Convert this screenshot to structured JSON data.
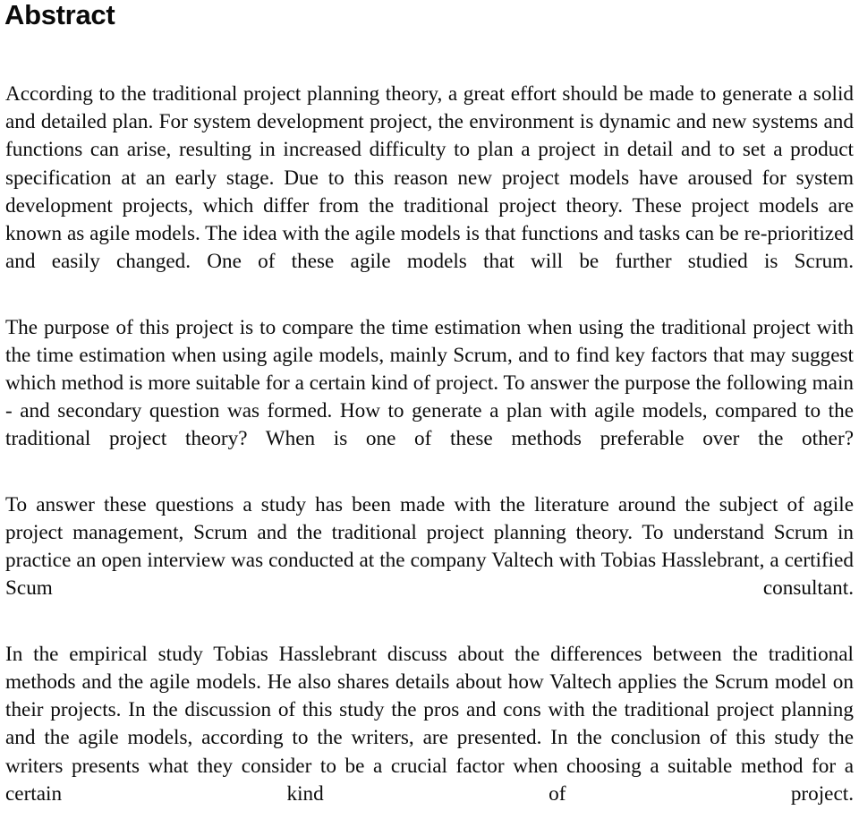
{
  "document": {
    "title": "Abstract",
    "paragraphs": [
      "According to the traditional project planning theory, a great effort should be made to generate a solid and detailed plan. For system development project, the environment is dynamic and new systems and functions can arise, resulting in increased difficulty to plan a project in detail and to set a product specification at an early stage. Due to this reason new project models have aroused for system development projects, which differ from the traditional project theory. These project models are known as agile models. The idea with the agile models is that functions and tasks can be re-prioritized and easily changed. One of these agile models that will be further studied is Scrum.",
      "The purpose of this project is to compare the time estimation when using the traditional project with the time estimation when using agile models, mainly Scrum, and to find key factors that may suggest which method is more suitable for a certain kind of project. To answer the purpose the following main - and secondary question was formed. How to generate a plan with agile models, compared to the traditional project theory? When is one of these methods preferable over the other?",
      "To answer these questions a study has been made with the literature around the subject of agile project management, Scrum and the traditional project planning theory. To understand Scrum in practice an open interview was conducted at the company Valtech with Tobias Hasslebrant, a certified Scum consultant.",
      "In the empirical study Tobias Hasslebrant discuss about the differences between the traditional methods and the agile models. He also shares details about how Valtech applies the Scrum model on their projects. In the discussion of this study the pros and cons with the traditional project planning and the agile models, according to the writers, are presented. In the conclusion of this study the writers presents what they consider to be a crucial factor when choosing a suitable method for a certain kind of project."
    ]
  },
  "colors": {
    "page_background": "#ffffff",
    "text": "#0c0c0c",
    "heading": "#0a0a0a"
  }
}
